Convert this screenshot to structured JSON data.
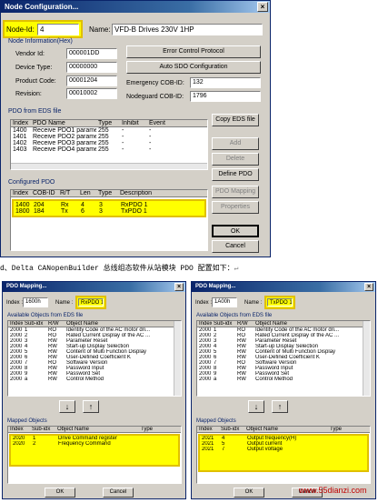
{
  "main_dialog": {
    "title": "Node Configuration...",
    "close": "×",
    "node_id_label": "Node-Id:",
    "node_id_value": "4",
    "name_label": "Name:",
    "name_value": "VFD-B Drives 230V 1HP",
    "info_group": "Node Information(Hex)",
    "vendor_label": "Vendor Id:",
    "vendor_value": "000001DD",
    "device_label": "Device Type:",
    "device_value": "00000000",
    "product_label": "Product Code:",
    "product_value": "00001204",
    "revision_label": "Revision:",
    "revision_value": "00010002",
    "error_button": "Error Control Protocol",
    "sdo_button": "Auto SDO Configuration",
    "emergency_label": "Emergency COB-ID:",
    "emergency_value": "132",
    "nodeguard_label": "Nodeguard COB-ID:",
    "nodeguard_value": "1796",
    "pdo_eds_group": "PDO from EDS file",
    "copy_eds_button": "Copy EDS file",
    "eds_headers": [
      "Index",
      "PDO Name",
      "Type",
      "Inhibit",
      "Event"
    ],
    "eds_rows": [
      [
        "1400",
        "Receive PDO1 parameter",
        "255",
        "-",
        "-"
      ],
      [
        "1401",
        "Receive PDO2 parameter",
        "255",
        "-",
        "-"
      ],
      [
        "1402",
        "Receive PDO3 parameter",
        "255",
        "-",
        "-"
      ],
      [
        "1403",
        "Receive PDO4 parameter",
        "255",
        "-",
        "-"
      ]
    ],
    "add_button": "Add",
    "delete_button": "Delete",
    "define_pdo_button": "Define PDO",
    "configured_group": "Configured PDO",
    "cfg_headers": [
      "Index",
      "COB-ID",
      "R/T",
      "Len",
      "Type",
      "Description"
    ],
    "cfg_rows": [
      [
        "1400",
        "204",
        "Rx",
        "4",
        "3",
        "RxPDO 1"
      ],
      [
        "1800",
        "184",
        "Tx",
        "6",
        "3",
        "TxPDO 1"
      ]
    ],
    "pdo_mapping_button": "PDO Mapping",
    "properties_button": "Properties",
    "ok_button": "OK",
    "cancel_button": "Cancel"
  },
  "caption": "d、Delta CANopenBuilder 总线组态软件从站模块 PDO 配置如下：",
  "caption_arrow": "↵",
  "left_mapping": {
    "title": "PDO Mapping...",
    "close": "×",
    "index_label": "Index :",
    "index_value": "1600h",
    "name_label": "Name :",
    "name_value": "RxPDO 1",
    "available_label": "Available Objects from EDS file",
    "headers": [
      "Index",
      "Sub-idx",
      "R/W",
      "Object Name"
    ],
    "rows": [
      [
        "2000",
        "1",
        "RO",
        "Identity Code of the AC motor dri..."
      ],
      [
        "2000",
        "2",
        "RO",
        "Rated Current Display of the AC ..."
      ],
      [
        "2000",
        "3",
        "RW",
        "Parameter Reset"
      ],
      [
        "2000",
        "4",
        "RW",
        "Start-up Display Selection"
      ],
      [
        "2000",
        "5",
        "RW",
        "Content of Multi Function Display"
      ],
      [
        "2000",
        "6",
        "RW",
        "User-Defined Coefficient K"
      ],
      [
        "2000",
        "7",
        "RO",
        "Software Version"
      ],
      [
        "2000",
        "8",
        "RW",
        "Password Input"
      ],
      [
        "2000",
        "9",
        "RW",
        "Password Set"
      ],
      [
        "2000",
        "a",
        "RW",
        "Control Method"
      ]
    ],
    "down_arrow": "↓",
    "up_arrow": "↑",
    "mapped_label": "Mapped Objects",
    "mapped_headers": [
      "Index",
      "Sub-idx",
      "Object Name",
      "Type"
    ],
    "mapped_rows": [
      [
        "2020",
        "1",
        "Drive Command register",
        ""
      ],
      [
        "2020",
        "2",
        "Frequency Command",
        ""
      ]
    ],
    "ok": "OK",
    "cancel": "Cancel"
  },
  "right_mapping": {
    "title": "PDO Mapping...",
    "close": "×",
    "index_label": "Index :",
    "index_value": "1A00h",
    "name_label": "Name :",
    "name_value": "TxPDO 1",
    "available_label": "Available Objects from EDS file",
    "headers": [
      "Index",
      "Sub-idx",
      "R/W",
      "Object Name"
    ],
    "rows": [
      [
        "2000",
        "1",
        "RO",
        "Identity Code of the AC motor dri..."
      ],
      [
        "2000",
        "2",
        "RO",
        "Rated Current Display of the AC ..."
      ],
      [
        "2000",
        "3",
        "RW",
        "Parameter Reset"
      ],
      [
        "2000",
        "4",
        "RW",
        "Start-up Display Selection"
      ],
      [
        "2000",
        "5",
        "RW",
        "Content of Multi Function Display"
      ],
      [
        "2000",
        "6",
        "RW",
        "User-Defined Coefficient K"
      ],
      [
        "2000",
        "7",
        "RO",
        "Software Version"
      ],
      [
        "2000",
        "8",
        "RW",
        "Password Input"
      ],
      [
        "2000",
        "9",
        "RW",
        "Password Set"
      ],
      [
        "2000",
        "a",
        "RW",
        "Control Method"
      ]
    ],
    "down_arrow": "↓",
    "up_arrow": "↑",
    "mapped_label": "Mapped Objects",
    "mapped_headers": [
      "Index",
      "Sub-idx",
      "Object Name",
      "Type"
    ],
    "mapped_rows": [
      [
        "2021",
        "4",
        "Output frequency(H)",
        ""
      ],
      [
        "2021",
        "5",
        "Output current",
        ""
      ],
      [
        "2021",
        "7",
        "Output voltage",
        ""
      ]
    ],
    "ok": "OK",
    "cancel": "Cancel"
  },
  "watermark": "www.55dianzi.com",
  "colors": {
    "title_bar": "#0a246a",
    "highlight": "#ffff00",
    "dialog_bg": "#d4d0c8",
    "group_text": "#0a246a"
  }
}
